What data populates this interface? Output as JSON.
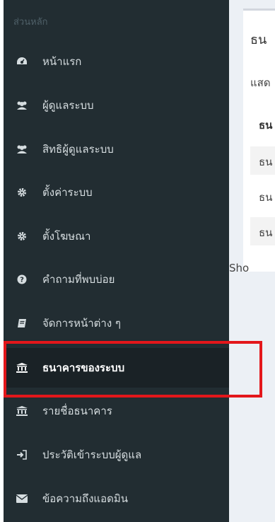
{
  "sidebar": {
    "header": "ส่วนหลัก",
    "items": [
      {
        "label": "หน้าแรก",
        "icon": "dashboard-icon"
      },
      {
        "label": "ผู้ดูแลระบบ",
        "icon": "users-icon"
      },
      {
        "label": "สิทธิผู้ดูแลระบบ",
        "icon": "users-icon"
      },
      {
        "label": "ตั้งค่าระบบ",
        "icon": "gear-icon"
      },
      {
        "label": "ตั้งโฆษณา",
        "icon": "gear-icon"
      },
      {
        "label": "คำถามที่พบบ่อย",
        "icon": "question-circle-icon"
      },
      {
        "label": "จัดการหน้าต่าง ๆ",
        "icon": "book-icon"
      },
      {
        "label": "ธนาคารของระบบ",
        "icon": "bank-icon",
        "active": true
      },
      {
        "label": "รายชื่อธนาคาร",
        "icon": "bank-icon"
      },
      {
        "label": "ประวัติเข้าระบบผู้ดูแล",
        "icon": "sign-in-icon"
      },
      {
        "label": "ข้อความถึงแอดมิน",
        "icon": "envelope-icon"
      }
    ]
  },
  "content": {
    "title": "ธน",
    "description": "แสด",
    "table_header": "ธน",
    "rows": [
      "ธน",
      "ธน",
      "ธน"
    ],
    "show_text": "Sho"
  },
  "colors": {
    "sidebar_bg": "#222d32",
    "active_bg": "#1a2226",
    "highlight_border": "#e3171b",
    "content_bg": "#ecf0f5"
  }
}
